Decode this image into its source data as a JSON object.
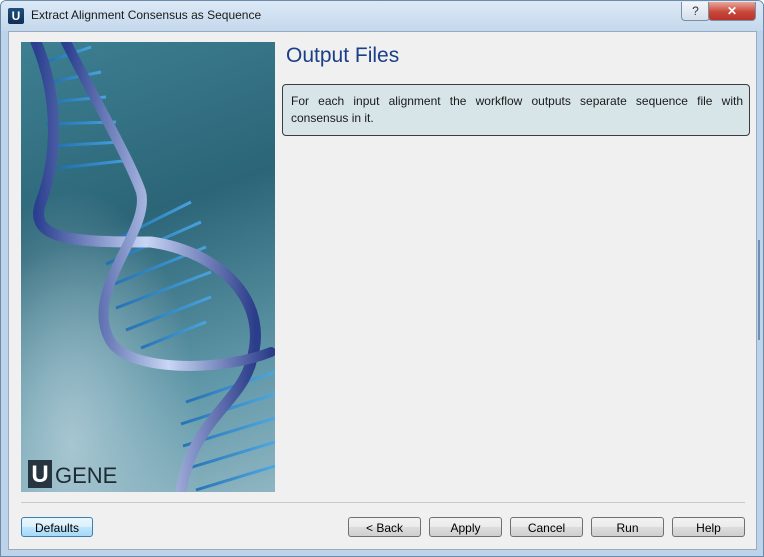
{
  "window": {
    "title": "Extract Alignment Consensus as Sequence",
    "app_icon_letter": "U",
    "help_glyph": "?",
    "close_glyph": "✕"
  },
  "banner": {
    "logo_letter": "U",
    "logo_text": "GENE"
  },
  "page": {
    "title": "Output Files",
    "description": "For each input alignment the workflow outputs separate sequence file with consensus in it."
  },
  "buttons": {
    "defaults": "Defaults",
    "back": "< Back",
    "apply": "Apply",
    "cancel": "Cancel",
    "run": "Run",
    "help": "Help"
  },
  "icons": {
    "app": "ugene-app-icon",
    "help": "help-icon",
    "close": "close-icon"
  },
  "colors": {
    "title_text": "#1a3f87",
    "info_box_bg": "#d7e5e9",
    "close_button": "#c8473a",
    "default_button_border": "#3c7fb1"
  }
}
